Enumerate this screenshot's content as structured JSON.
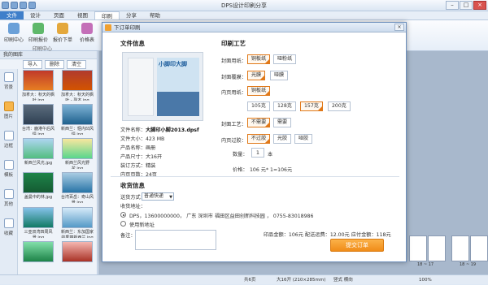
{
  "app": {
    "title": "DPS设计印刷分享"
  },
  "menu": [
    "文件",
    "设计",
    "页面",
    "视图",
    "印刷",
    "分享",
    "帮助"
  ],
  "ribbon": {
    "buttons": [
      "印刷中心",
      "印刷报价",
      "报价下单",
      "价格表"
    ],
    "group_label": "印刷中心"
  },
  "left_panel": {
    "header": "我的图库",
    "tools": [
      "导入",
      "删除",
      "清空"
    ],
    "side_icons": [
      "背景",
      "图片",
      "边框",
      "模板",
      "其他",
      "收藏"
    ],
    "thumbs": [
      "加拿大：秋天的枫叶.jpg",
      "加拿大：秋天的枫叶 - 副本.jpg",
      "台湾：鹿港午后风情.jpg",
      "新西兰：惬内凹风情.jpg",
      "新西兰风光.jpg",
      "新西兰风光野花.jpg",
      "盖曼中的林.jpg",
      "台湾百岳：奇山风景.jpg",
      "三亚双湾四周风景.jpg",
      "新西兰：东加国家的秀丽新西兰.jpg",
      "",
      "",
      "",
      ""
    ]
  },
  "dialog": {
    "title": "下订单印刷",
    "file_info": {
      "heading": "文件信息",
      "cover_title": "小脚印大脚",
      "rows": [
        [
          "文件名称：",
          "大脚印小脚2013.dpsf"
        ],
        [
          "文件大小：",
          "423 MB"
        ],
        [
          "产品名称：",
          "画册"
        ],
        [
          "产品尺寸：",
          "大16开"
        ],
        [
          "装订方式：",
          "精装"
        ],
        [
          "内页页数：",
          "24页"
        ]
      ]
    },
    "craft": {
      "heading": "印刷工艺",
      "cover_paper_label": "封面用纸：",
      "cover_paper_opts": [
        "铜板纸",
        "哑粉纸"
      ],
      "cover_film_label": "封面覆膜：",
      "cover_film_opts": [
        "光膜",
        "哑膜"
      ],
      "inner_paper_label": "内页用纸：",
      "inner_paper_opts": [
        "铜板纸"
      ],
      "weight_opts": [
        "105克",
        "128克",
        "157克",
        "200克"
      ],
      "cover_craft_label": "封面工艺：",
      "cover_craft_opts": [
        "不需要",
        "需要"
      ],
      "inner_film_label": "内页过胶：",
      "inner_film_opts": [
        "不过胶",
        "光胶",
        "哑胶"
      ],
      "qty_label": "数量：",
      "qty_value": "1",
      "qty_unit": "本",
      "price_label": "价格：",
      "price_value": "106 元* 1=106元"
    },
    "shipping": {
      "heading": "收货信息",
      "method_label": "送货方式：",
      "method_value": "普通快递",
      "address_label": "收货地址：",
      "address_option": "DPS，13600000000， 广东 深圳市 福田区益田创新科技园 ， 0755-83018986",
      "new_address": "使用新地址",
      "note_label": "备注："
    },
    "totals": "印品金额：106元  配送运费：12.00元  应付金额：118元",
    "submit_label": "提交订单"
  },
  "status": {
    "pages": "共6页",
    "mode": "大16开 (210×285mm)",
    "orient": "竖式 横向",
    "zoom": "100%",
    "right_pages": [
      "18 ~ 17",
      "18 ~ 19"
    ]
  },
  "colors": {
    "accent": "#f08c18",
    "brand": "#3f7fca"
  }
}
